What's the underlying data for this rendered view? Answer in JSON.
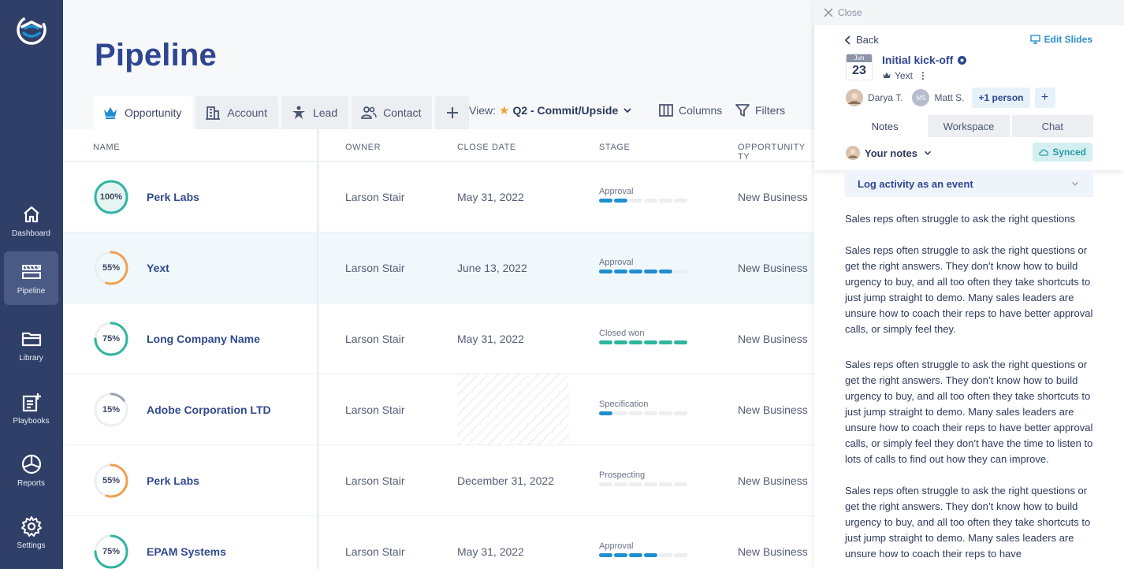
{
  "sidebar": {
    "items": [
      {
        "label": "Dashboard",
        "icon": "home-icon"
      },
      {
        "label": "Pipeline",
        "icon": "pipeline-icon"
      },
      {
        "label": "Library",
        "icon": "folder-icon"
      },
      {
        "label": "Playbooks",
        "icon": "playbook-icon"
      },
      {
        "label": "Reports",
        "icon": "pie-chart-icon"
      },
      {
        "label": "Settings",
        "icon": "gear-icon"
      }
    ],
    "active": "Pipeline"
  },
  "page": {
    "title": "Pipeline"
  },
  "tabs": [
    {
      "label": "Opportunity",
      "icon": "crown-icon"
    },
    {
      "label": "Account",
      "icon": "building-icon"
    },
    {
      "label": "Lead",
      "icon": "person-star-icon"
    },
    {
      "label": "Contact",
      "icon": "contacts-icon"
    }
  ],
  "toolbar": {
    "view_label": "View:",
    "view_value": "Q2 - Commit/Upside",
    "columns_label": "Columns",
    "filters_label": "Filters"
  },
  "table": {
    "headers": [
      "NAME",
      "OWNER",
      "CLOSE DATE",
      "STAGE",
      "OPPORTUNITY TY"
    ],
    "rows": [
      {
        "pct": "100%",
        "progress": 1.0,
        "name": "Perk Labs",
        "owner": "Larson Stair",
        "close_date": "May 31, 2022",
        "stage": "Approval",
        "stage_filled": 2,
        "type": "New Business"
      },
      {
        "pct": "55%",
        "progress": 0.55,
        "name": "Yext",
        "owner": "Larson Stair",
        "close_date": "June 13, 2022",
        "stage": "Approval",
        "stage_filled": 5,
        "type": "New Business"
      },
      {
        "pct": "75%",
        "progress": 0.75,
        "name": "Long Company Name",
        "owner": "Larson Stair",
        "close_date": "May 31, 2022",
        "stage": "Closed won",
        "stage_filled": 6,
        "type": "New Business"
      },
      {
        "pct": "15%",
        "progress": 0.15,
        "name": "Adobe Corporation LTD",
        "owner": "Larson Stair",
        "close_date": "",
        "stage": "Specification",
        "stage_filled": 1,
        "type": "New Business"
      },
      {
        "pct": "55%",
        "progress": 0.55,
        "name": "Perk Labs",
        "owner": "Larson Stair",
        "close_date": "December 31, 2022",
        "stage": "Prospecting",
        "stage_filled": 0,
        "type": "New Business"
      },
      {
        "pct": "75%",
        "progress": 0.75,
        "name": "EPAM Systems",
        "owner": "Larson Stair",
        "close_date": "May 31, 2022",
        "stage": "Approval",
        "stage_filled": 4,
        "type": "New Business"
      }
    ]
  },
  "panel": {
    "close_label": "Close",
    "back_label": "Back",
    "edit_slides_label": "Edit Slides",
    "event": {
      "month": "Jun",
      "day": "23",
      "title": "Initial kick-off",
      "company": "Yext"
    },
    "people": [
      "Darya T.",
      "Matt S."
    ],
    "people_initials": "MS",
    "more_people": "+1 person",
    "tabs": [
      "Notes",
      "Workspace",
      "Chat"
    ],
    "your_notes_label": "Your notes",
    "synced_label": "Synced",
    "log_activity_label": "Log activity as an event",
    "notes": [
      "Sales reps often struggle to ask the right questions",
      "Sales reps often struggle to ask the right questions or get the right answers. They don’t know how to build urgency to buy, and  all too often they take shortcuts to just jump straight to demo. Many sales leaders are unsure how to coach their reps to have better approval calls, or simply feel they.",
      "Sales reps often struggle to ask the right questions or get the right answers. They don’t know how to build urgency to buy, and  all too often they take shortcuts to just jump straight to demo. Many sales leaders are unsure how to coach their reps to have better approval calls, or simply feel they don’t have the time to listen to lots of calls to find out how they can improve.",
      "Sales reps often struggle to ask the right questions or get the right answers. They don’t know how to build urgency to buy, and  all too often they take shortcuts to just jump straight to demo. Many sales leaders are unsure how to coach their reps to have"
    ]
  },
  "colors": {
    "sidebar": "#2f3f68",
    "brand": "#2f4690",
    "teal": "#2fb5a0",
    "blue": "#1f8fd0",
    "orange": "#f0a050",
    "gray": "#9aa2b2"
  }
}
